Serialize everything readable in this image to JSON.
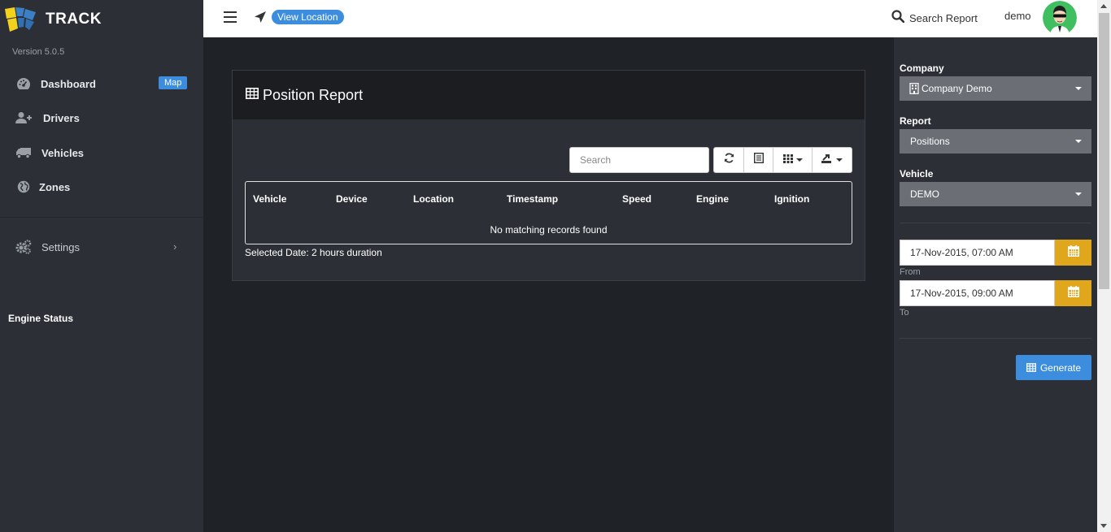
{
  "app": {
    "brand": "TRACK",
    "version": "Version 5.0.5"
  },
  "sidebar": {
    "items": [
      {
        "label": "Dashboard",
        "icon": "dashboard-icon",
        "badge": "Map"
      },
      {
        "label": "Drivers",
        "icon": "user-plus-icon"
      },
      {
        "label": "Vehicles",
        "icon": "truck-icon"
      },
      {
        "label": "Zones",
        "icon": "globe-icon"
      },
      {
        "label": "Settings",
        "icon": "gears-icon",
        "chevron": "›"
      }
    ],
    "engine_status_label": "Engine Status"
  },
  "topbar": {
    "view_location": "View Location",
    "search_report": "Search Report",
    "user": "demo"
  },
  "report": {
    "title": "Position Report",
    "search_placeholder": "Search",
    "columns": [
      "Vehicle",
      "Device",
      "Location",
      "Timestamp",
      "Speed",
      "Engine",
      "Ignition"
    ],
    "empty_message": "No matching records found",
    "selected_date": "Selected Date: 2 hours duration"
  },
  "filters": {
    "company_label": "Company",
    "company_value": "Company Demo",
    "report_label": "Report",
    "report_value": "Positions",
    "vehicle_label": "Vehicle",
    "vehicle_value": "DEMO",
    "from_value": "17-Nov-2015, 07:00 AM",
    "from_label": "From",
    "to_value": "17-Nov-2015, 09:00 AM",
    "to_label": "To",
    "generate_label": "Generate"
  },
  "colors": {
    "accent_blue": "#3c8dde",
    "calendar_gold": "#e0a61c",
    "sidebar_bg": "#2c3036",
    "main_bg": "#1f2227"
  }
}
